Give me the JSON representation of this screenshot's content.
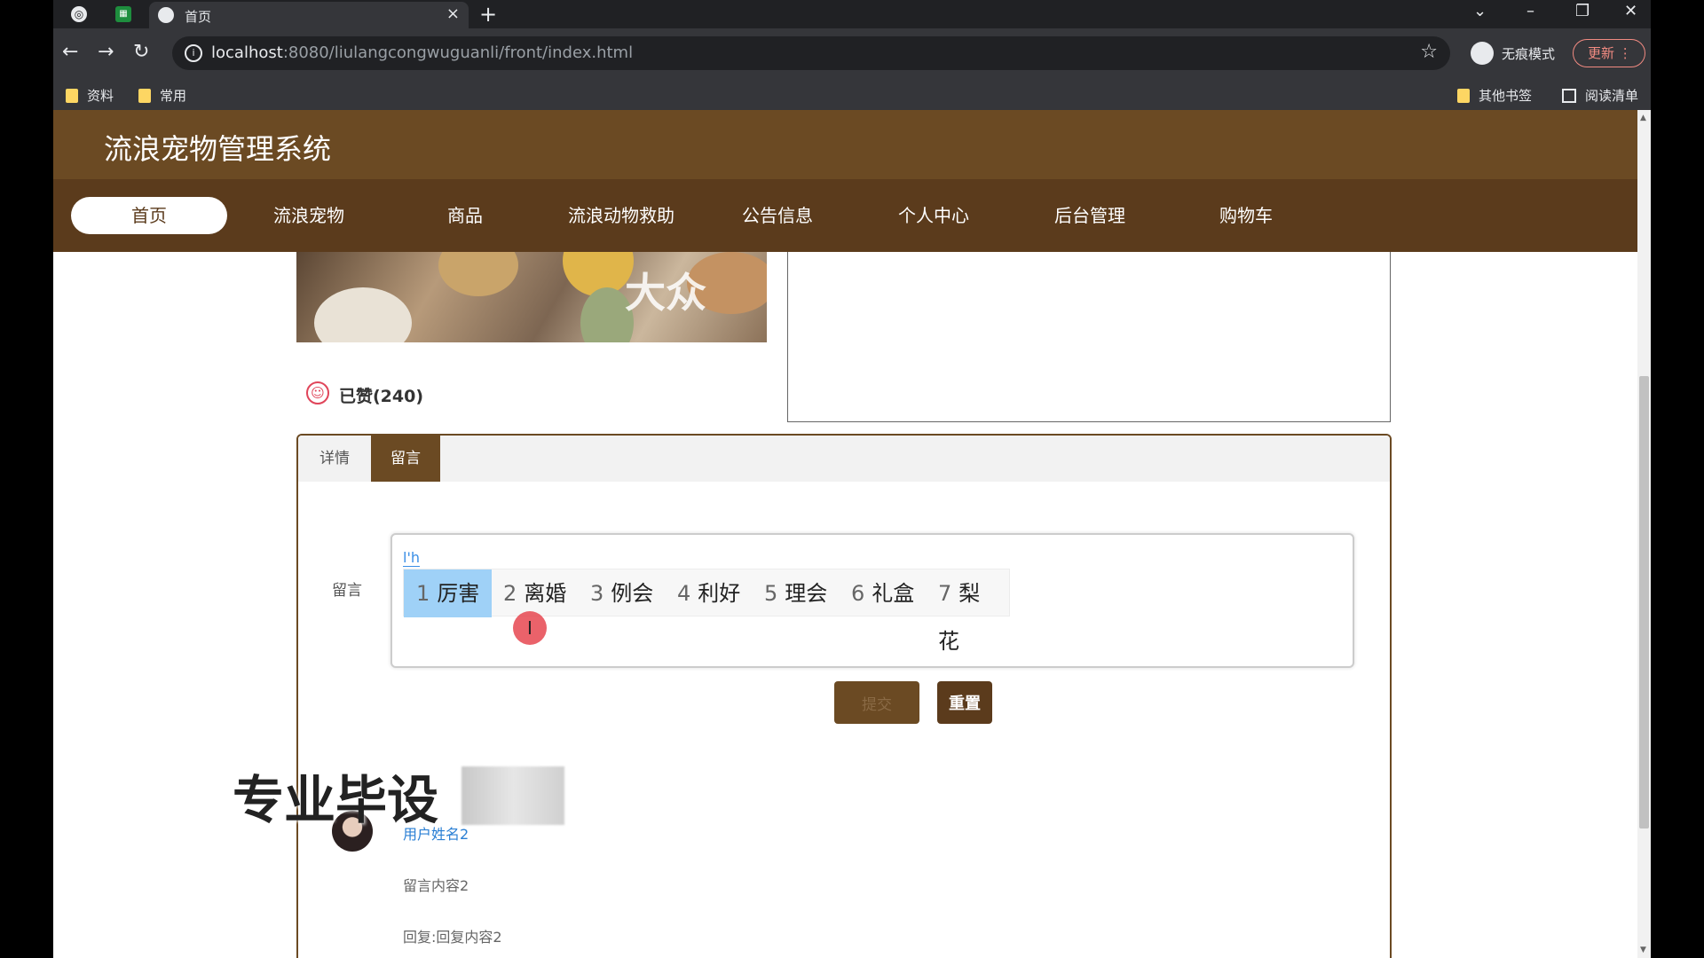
{
  "browser": {
    "tab_title": "首页",
    "url_host": "localhost",
    "url_rest": ":8080/liulangcongwuguanli/front/index.html",
    "incognito_label": "无痕模式",
    "update_label": "更新",
    "bookmarks": [
      "资料",
      "常用"
    ],
    "other_bookmarks": "其他书签",
    "reading_list": "阅读清单"
  },
  "site": {
    "title": "流浪宠物管理系统",
    "nav": [
      "首页",
      "流浪宠物",
      "商品",
      "流浪动物救助",
      "公告信息",
      "个人中心",
      "后台管理",
      "购物车"
    ]
  },
  "photo": {
    "watermark": "大众"
  },
  "like": {
    "label": "已赞(240)"
  },
  "tabs": [
    "详情",
    "留言"
  ],
  "form": {
    "label": "留言",
    "ime_composition": "l'h",
    "candidates": [
      {
        "num": "1",
        "text": "厉害"
      },
      {
        "num": "2",
        "text": "离婚"
      },
      {
        "num": "3",
        "text": "例会"
      },
      {
        "num": "4",
        "text": "利好"
      },
      {
        "num": "5",
        "text": "理会"
      },
      {
        "num": "6",
        "text": "礼盒"
      },
      {
        "num": "7",
        "text": "梨花"
      }
    ],
    "submit_label": "提交",
    "reset_label": "重置"
  },
  "comments": [
    {
      "user": "用户姓名2",
      "text": "留言内容2",
      "reply": "回复:回复内容2"
    }
  ],
  "overlay": {
    "text": "专业毕设"
  },
  "colors": {
    "brand": "#6b4a23",
    "nav": "#5b3b1c",
    "link": "#2a7fd4"
  }
}
